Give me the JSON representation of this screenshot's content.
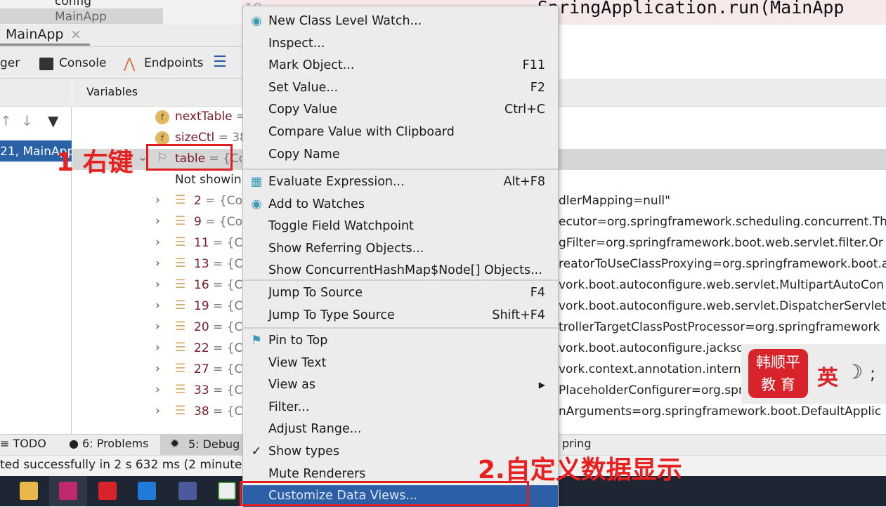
{
  "project_tree": {
    "items": [
      "config",
      "MainApp"
    ]
  },
  "editor": {
    "line_number": "19",
    "code": "SpringApplication.run(MainApp"
  },
  "run_tab": {
    "label": "MainApp",
    "close": "×"
  },
  "debug_toolbar": {
    "tabs": [
      "ger",
      "Console",
      "Endpoints"
    ]
  },
  "frames": {
    "selected": "21, MainApp"
  },
  "variables": {
    "header": "Variables",
    "rows": [
      {
        "name": "nextTable",
        "rest": " = "
      },
      {
        "name": "sizeCtl",
        "rest": " = 38"
      },
      {
        "name": "table",
        "rest": " = {Co"
      }
    ],
    "not_showing": "Not showin",
    "entries": [
      "2",
      "9",
      "11",
      "13",
      "16",
      "19",
      "20",
      "22",
      "27",
      "33",
      "38"
    ],
    "entry_rest": " = {Co"
  },
  "right_values": [
    "dlerMapping=null\"",
    "ecutor=org.springframework.scheduling.concurrent.Thr",
    "gFilter=org.springframework.boot.web.servlet.filter.Or",
    "reatorToUseClassProxying=org.springframework.boot.a",
    "vork.boot.autoconfigure.web.servlet.MultipartAutoCon",
    "vork.boot.autoconfigure.web.servlet.DispatcherServletA",
    "trollerTargetClassPostProcessor=org.springframework",
    "vork.boot.autoconfigure.jackson",
    "vork.context.annotation.internal",
    "PlaceholderConfigurer=org.spri",
    "nArguments=org.springframework.boot.DefaultApplic"
  ],
  "bottom_tools": [
    "TODO",
    "6: Problems",
    "5: Debug",
    "pring"
  ],
  "status": "ted successfully in 2 s 632 ms (2 minutes",
  "context_menu": {
    "group1": [
      {
        "label": "New Class Level Watch...",
        "icon": "class-watch-icon"
      },
      {
        "label": "Inspect..."
      },
      {
        "label": "Mark Object...",
        "shortcut": "F11"
      },
      {
        "label": "Set Value...",
        "shortcut": "F2"
      },
      {
        "label": "Copy Value",
        "shortcut": "Ctrl+C"
      },
      {
        "label": "Compare Value with Clipboard"
      },
      {
        "label": "Copy Name"
      }
    ],
    "group2": [
      {
        "label": "Evaluate Expression...",
        "shortcut": "Alt+F8",
        "icon": "calculator-icon"
      },
      {
        "label": "Add to Watches",
        "icon": "watch-icon"
      },
      {
        "label": "Toggle Field Watchpoint"
      },
      {
        "label": "Show Referring Objects..."
      },
      {
        "label": "Show ConcurrentHashMap$Node[] Objects..."
      }
    ],
    "group3": [
      {
        "label": "Jump To Source",
        "shortcut": "F4"
      },
      {
        "label": "Jump To Type Source",
        "shortcut": "Shift+F4"
      }
    ],
    "group4": [
      {
        "label": "Pin to Top",
        "icon": "pin-icon"
      },
      {
        "label": "View Text"
      },
      {
        "label": "View as",
        "submenu": "▶"
      },
      {
        "label": "Filter..."
      },
      {
        "label": "Adjust Range..."
      },
      {
        "label": "Show types",
        "checked": "✓"
      },
      {
        "label": "Mute Renderers"
      },
      {
        "label": "Customize Data Views..."
      }
    ]
  },
  "annotations": {
    "step1": "1 右键",
    "step2": "2.自定义数据显示"
  },
  "watermark": {
    "line1": "韩顺平",
    "line2": "教 育",
    "ime": "英",
    "ime_moon": "☽",
    "ime_punct": ";"
  },
  "colors": {
    "accent": "#2d5fa6",
    "annotation": "#e82020",
    "watermark": "#d8232a"
  }
}
